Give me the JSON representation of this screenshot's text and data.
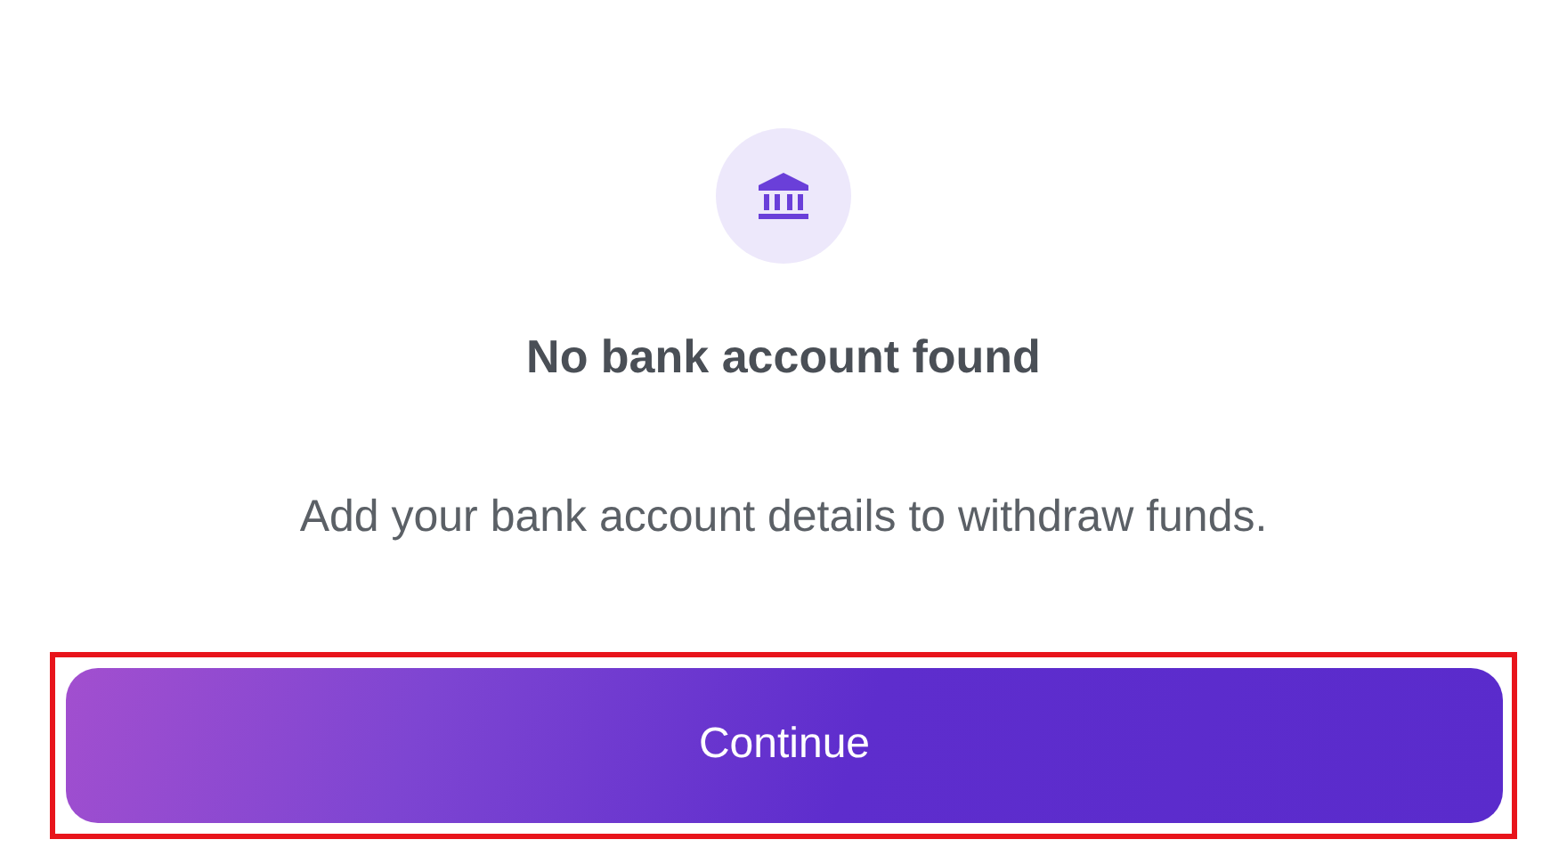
{
  "empty_state": {
    "title": "No bank account found",
    "message": "Add your bank account details to withdraw funds."
  },
  "button": {
    "label": "Continue",
    "highlighted": true
  }
}
